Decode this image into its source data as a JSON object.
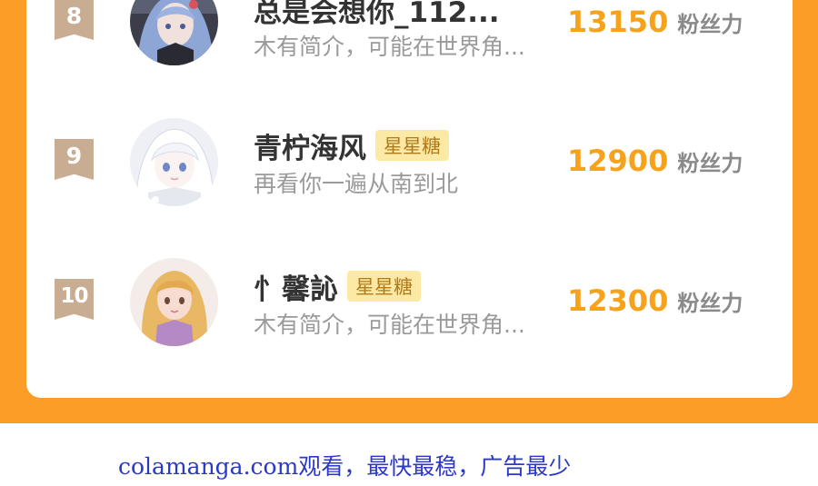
{
  "ranking": {
    "rows": [
      {
        "rank": "8",
        "name": "总是会想你_112...",
        "badge": "",
        "bio": "木有简介，可能在世界角...",
        "score": "13150",
        "score_unit": "粉丝力"
      },
      {
        "rank": "9",
        "name": "青柠海风",
        "badge": "星星糖",
        "bio": "再看你一遍从南到北",
        "score": "12900",
        "score_unit": "粉丝力"
      },
      {
        "rank": "10",
        "name": "忄馨訫",
        "badge": "星星糖",
        "bio": "木有简介，可能在世界角...",
        "score": "12300",
        "score_unit": "粉丝力"
      }
    ]
  },
  "footer": {
    "text": "colamanga.com观看，最快最稳，广告最少"
  },
  "colors": {
    "background_orange": "#fb9d26",
    "score": "#f7a21b",
    "badge_bg": "#fde9a6",
    "footer_text": "#2c38c8"
  }
}
